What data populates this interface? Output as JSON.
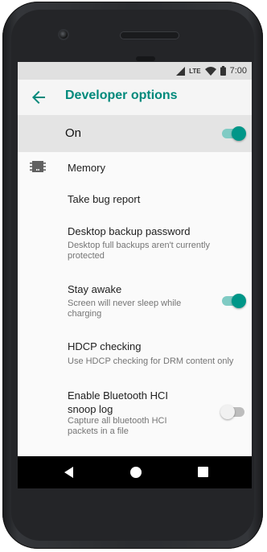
{
  "status_bar": {
    "network": "LTE",
    "time": "7:00"
  },
  "toolbar": {
    "title": "Developer options",
    "back_icon": "arrow-left-icon"
  },
  "master_switch": {
    "label": "On",
    "checked": true
  },
  "settings": [
    {
      "title": "Memory",
      "icon": "memory-chip-icon"
    },
    {
      "title": "Take bug report"
    },
    {
      "title": "Desktop backup password",
      "summary": "Desktop full backups aren't currently protected"
    },
    {
      "title": "Stay awake",
      "summary": "Screen will never sleep while charging",
      "checked": true
    },
    {
      "title": "HDCP checking",
      "summary": "Use HDCP checking for DRM content only"
    },
    {
      "title": "Enable Bluetooth HCI snoop log",
      "summary": "Capture all bluetooth HCI packets in a file",
      "checked": false
    }
  ],
  "nav_bar": {
    "back_icon": "triangle-back-icon",
    "home_icon": "circle-home-icon",
    "recents_icon": "square-recents-icon"
  },
  "colors": {
    "accent": "#009688",
    "title": "#00897b",
    "status_bar": "#e0e0e0",
    "toolbar": "#f5f5f5",
    "master_bg": "#e4e4e4"
  }
}
